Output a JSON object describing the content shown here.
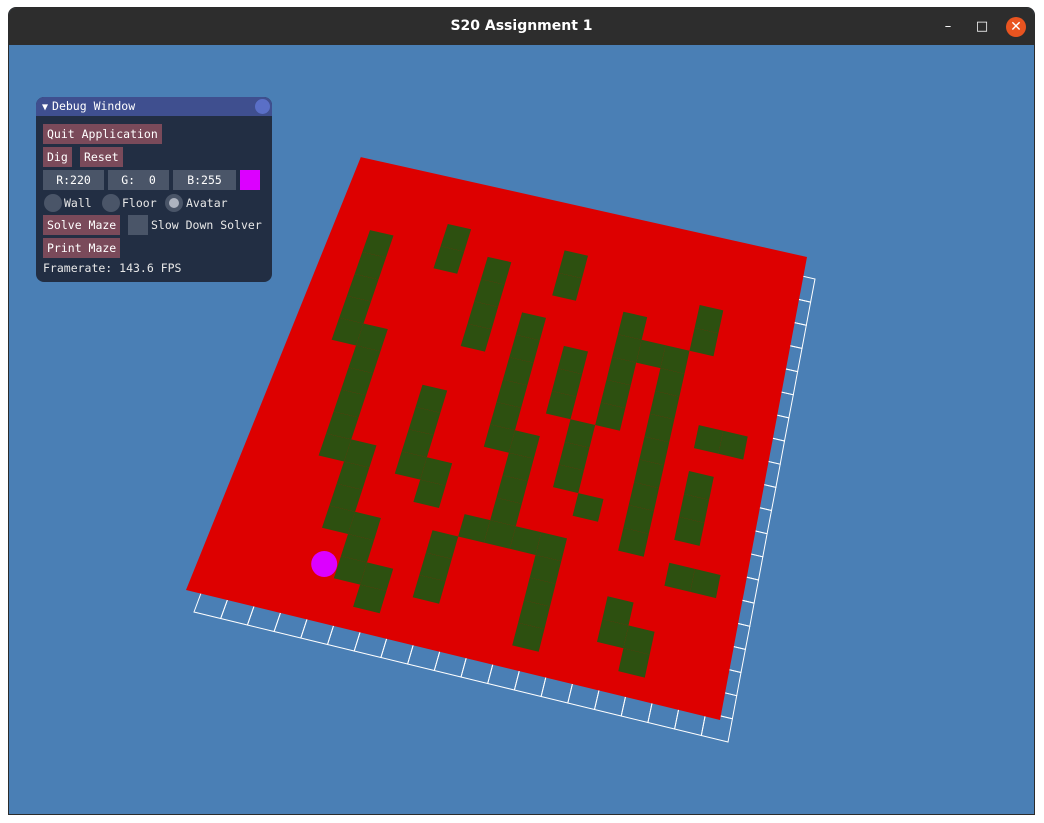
{
  "window": {
    "title": "S20 Assignment 1",
    "minimize_glyph": "–",
    "maximize_glyph": "□",
    "close_glyph": "✕"
  },
  "debug": {
    "title": "Debug Window",
    "collapse_glyph": "▼",
    "quit_label": "Quit Application",
    "dig_label": "Dig",
    "reset_label": "Reset",
    "r_text": "R:220",
    "g_text": "G:  0",
    "b_text": "B:255",
    "radio_wall": "Wall",
    "radio_floor": "Floor",
    "radio_avatar": "Avatar",
    "selected_radio": "Avatar",
    "solve_label": "Solve Maze",
    "slow_label": "Slow Down Solver",
    "print_label": "Print Maze",
    "framerate_text": "Framerate: 143.6 FPS"
  },
  "colors": {
    "background": "#4a7fb5",
    "wall": "#dd0000",
    "floor": "#2d5010",
    "avatar": "#dc00ff",
    "grid": "#ffffff"
  },
  "maze": {
    "rows": 20,
    "cols": 20,
    "floor_cells": [
      [
        3,
        2
      ],
      [
        4,
        2
      ],
      [
        5,
        2
      ],
      [
        6,
        2
      ],
      [
        7,
        2
      ],
      [
        2,
        5
      ],
      [
        3,
        5
      ],
      [
        7,
        3
      ],
      [
        8,
        3
      ],
      [
        9,
        3
      ],
      [
        10,
        3
      ],
      [
        11,
        3
      ],
      [
        12,
        3
      ],
      [
        12,
        4
      ],
      [
        13,
        4
      ],
      [
        14,
        4
      ],
      [
        15,
        4
      ],
      [
        15,
        5
      ],
      [
        16,
        5
      ],
      [
        17,
        5
      ],
      [
        17,
        6
      ],
      [
        18,
        6
      ],
      [
        3,
        7
      ],
      [
        4,
        7
      ],
      [
        5,
        7
      ],
      [
        6,
        7
      ],
      [
        9,
        6
      ],
      [
        10,
        6
      ],
      [
        11,
        6
      ],
      [
        12,
        6
      ],
      [
        12,
        7
      ],
      [
        13,
        7
      ],
      [
        5,
        9
      ],
      [
        6,
        9
      ],
      [
        7,
        9
      ],
      [
        8,
        9
      ],
      [
        9,
        9
      ],
      [
        10,
        9
      ],
      [
        10,
        10
      ],
      [
        11,
        10
      ],
      [
        12,
        10
      ],
      [
        13,
        10
      ],
      [
        14,
        10
      ],
      [
        6,
        11
      ],
      [
        7,
        11
      ],
      [
        8,
        11
      ],
      [
        15,
        8
      ],
      [
        16,
        8
      ],
      [
        17,
        8
      ],
      [
        14,
        12
      ],
      [
        15,
        12
      ],
      [
        16,
        12
      ],
      [
        17,
        12
      ],
      [
        18,
        12
      ],
      [
        14,
        9
      ],
      [
        14,
        11
      ],
      [
        2,
        10
      ],
      [
        3,
        10
      ],
      [
        9,
        12
      ],
      [
        10,
        12
      ],
      [
        11,
        12
      ],
      [
        4,
        13
      ],
      [
        5,
        13
      ],
      [
        6,
        13
      ],
      [
        7,
        13
      ],
      [
        8,
        13
      ],
      [
        5,
        14
      ],
      [
        5,
        15
      ],
      [
        6,
        15
      ],
      [
        7,
        15
      ],
      [
        8,
        15
      ],
      [
        9,
        15
      ],
      [
        10,
        15
      ],
      [
        11,
        15
      ],
      [
        12,
        15
      ],
      [
        13,
        15
      ],
      [
        16,
        15
      ],
      [
        17,
        15
      ],
      [
        17,
        16
      ],
      [
        18,
        16
      ],
      [
        10,
        17
      ],
      [
        11,
        17
      ],
      [
        12,
        17
      ],
      [
        14,
        17
      ],
      [
        14,
        18
      ],
      [
        8,
        17
      ],
      [
        8,
        18
      ],
      [
        3,
        16
      ],
      [
        4,
        16
      ],
      [
        12,
        13
      ]
    ],
    "avatar_cell": [
      17,
      4
    ]
  }
}
